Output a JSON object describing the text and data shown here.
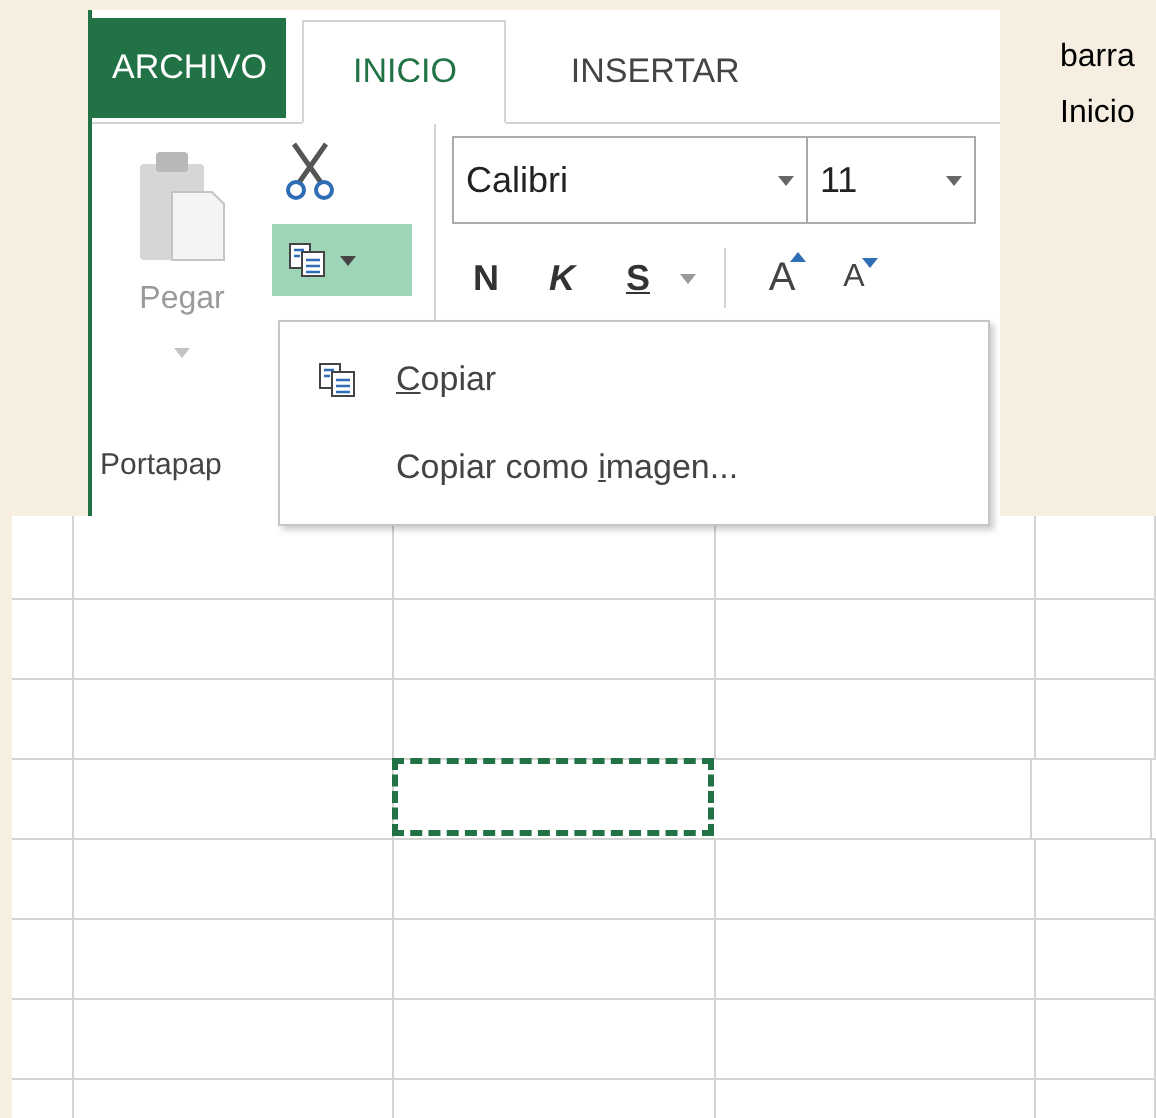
{
  "ribbon": {
    "tabs": [
      {
        "label": "ARCHIVO",
        "kind": "file",
        "selected": false
      },
      {
        "label": "INICIO",
        "kind": "tab",
        "selected": true
      },
      {
        "label": "INSERTAR",
        "kind": "tab",
        "selected": false
      }
    ],
    "paste": {
      "label": "Pegar",
      "disabled": true
    },
    "copy_button": {
      "pressed": true
    },
    "group_label": "Portapap",
    "font": {
      "value": "Calibri"
    },
    "size": {
      "value": "11"
    },
    "format_buttons": [
      {
        "label": "N",
        "kind": "bold"
      },
      {
        "label": "K",
        "kind": "italic"
      },
      {
        "label": "S",
        "kind": "underline"
      }
    ],
    "size_buttons": [
      {
        "label": "A",
        "kind": "grow"
      },
      {
        "label": "A",
        "kind": "shrink"
      }
    ]
  },
  "menu": {
    "items": [
      {
        "key": "C",
        "after": "opiar",
        "has_icon": true
      },
      {
        "before": "Copiar como ",
        "key": "i",
        "after": "magen...",
        "has_icon": false
      }
    ]
  },
  "side_text": [
    "barra",
    "Inicio"
  ],
  "grid": {
    "rows": [
      {
        "copy_marquee": [
          false,
          false,
          false,
          false,
          false
        ]
      },
      {
        "copy_marquee": [
          false,
          false,
          false,
          false,
          false
        ]
      },
      {
        "copy_marquee": [
          false,
          false,
          false,
          false,
          false
        ]
      },
      {
        "copy_marquee": [
          false,
          false,
          true,
          false,
          false
        ]
      },
      {
        "copy_marquee": [
          false,
          false,
          false,
          false,
          false
        ]
      },
      {
        "copy_marquee": [
          false,
          false,
          false,
          false,
          false
        ]
      },
      {
        "copy_marquee": [
          false,
          false,
          false,
          false,
          false
        ]
      },
      {
        "copy_marquee": [
          false,
          false,
          false,
          false,
          false
        ]
      }
    ]
  }
}
